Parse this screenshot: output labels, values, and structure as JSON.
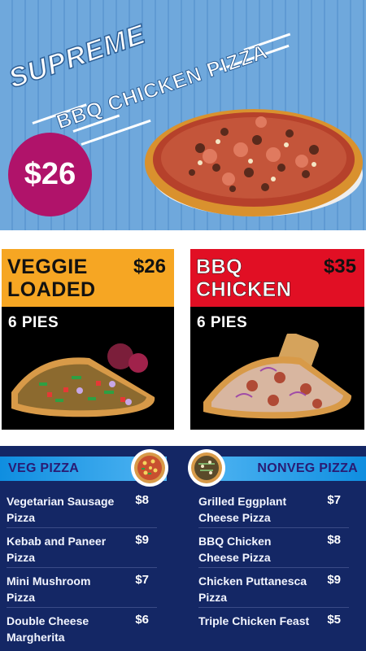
{
  "hero": {
    "title_line1": "SUPREME",
    "title_line2": "BBQ CHICKEN PIZZA",
    "price": "$26",
    "colors": {
      "background": "#6fa8dc",
      "price_circle": "#b0136a"
    }
  },
  "promos": [
    {
      "name_line1": "VEGGIE",
      "name_line2": "LOADED",
      "price": "$26",
      "pies": "6 PIES",
      "header_color": "#f6a623"
    },
    {
      "name_line1": "BBQ",
      "name_line2": "CHICKEN",
      "price": "$35",
      "pies": "6 PIES",
      "header_color": "#e10f24"
    }
  ],
  "menu": {
    "veg": {
      "title": "VEG PIZZA",
      "items": [
        {
          "name": "Vegetarian Sausage Pizza",
          "price": "$8"
        },
        {
          "name": "Kebab and Paneer Pizza",
          "price": "$9"
        },
        {
          "name": "Mini Mushroom Pizza",
          "price": "$7"
        },
        {
          "name": "Double Cheese Margherita",
          "price": "$6"
        }
      ]
    },
    "nonveg": {
      "title": "NONVEG PIZZA",
      "items": [
        {
          "name": "Grilled Eggplant Cheese Pizza",
          "price": "$7"
        },
        {
          "name": "BBQ Chicken Cheese Pizza",
          "price": "$8"
        },
        {
          "name": "Chicken Puttanesca Pizza",
          "price": "$9"
        },
        {
          "name": "Triple Chicken Feast",
          "price": "$5"
        }
      ]
    },
    "colors": {
      "background": "#142765",
      "bar": "#1a9be6"
    }
  }
}
